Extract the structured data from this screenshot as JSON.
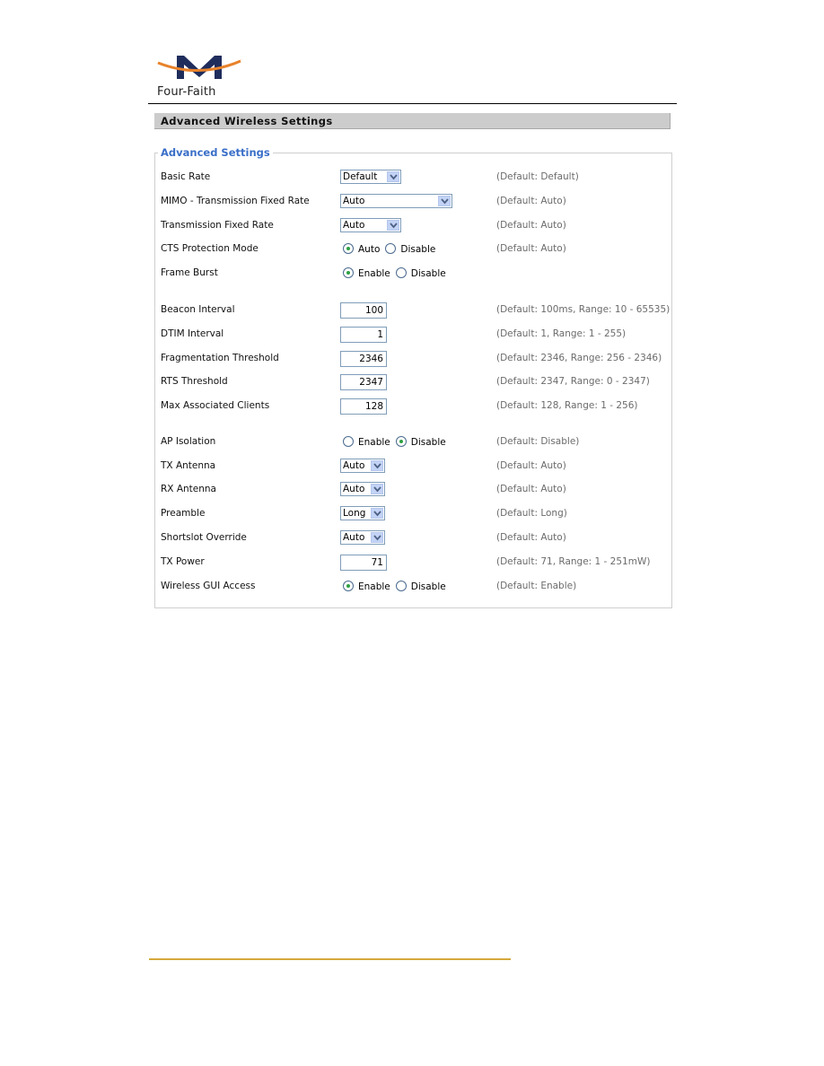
{
  "brand": {
    "name": "Four-Faith",
    "colors": {
      "mark": "#1f2d5c",
      "swoosh": "#e8822a",
      "footer_rule": "#d4a93a",
      "legend": "#3a6fc8"
    }
  },
  "section_title": "Advanced Wireless Settings",
  "fieldset_legend": "Advanced Settings",
  "rows": [
    {
      "label": "Basic Rate",
      "type": "select",
      "value": "Default",
      "hint": "(Default: Default)"
    },
    {
      "label": "MIMO - Transmission Fixed Rate",
      "type": "select",
      "value": "Auto",
      "hint": "(Default: Auto)"
    },
    {
      "label": "Transmission Fixed Rate",
      "type": "select",
      "value": "Auto",
      "hint": "(Default: Auto)"
    },
    {
      "label": "CTS Protection Mode",
      "type": "radio",
      "options": [
        "Auto",
        "Disable"
      ],
      "selected": "Auto",
      "hint": "(Default: Auto)"
    },
    {
      "label": "Frame Burst",
      "type": "radio",
      "options": [
        "Enable",
        "Disable"
      ],
      "selected": "Enable",
      "hint": ""
    },
    {
      "label": "Beacon Interval",
      "type": "text",
      "value": "100",
      "hint": "(Default: 100ms, Range: 10 - 65535)"
    },
    {
      "label": "DTIM Interval",
      "type": "text",
      "value": "1",
      "hint": "(Default: 1, Range: 1 - 255)"
    },
    {
      "label": "Fragmentation Threshold",
      "type": "text",
      "value": "2346",
      "hint": "(Default: 2346, Range: 256 - 2346)"
    },
    {
      "label": "RTS Threshold",
      "type": "text",
      "value": "2347",
      "hint": "(Default: 2347, Range: 0 - 2347)"
    },
    {
      "label": "Max Associated Clients",
      "type": "text",
      "value": "128",
      "hint": "(Default: 128, Range: 1 - 256)"
    },
    {
      "label": "AP Isolation",
      "type": "radio",
      "options": [
        "Enable",
        "Disable"
      ],
      "selected": "Disable",
      "hint": "(Default: Disable)"
    },
    {
      "label": "TX Antenna",
      "type": "select",
      "value": "Auto",
      "hint": "(Default: Auto)"
    },
    {
      "label": "RX Antenna",
      "type": "select",
      "value": "Auto",
      "hint": "(Default: Auto)"
    },
    {
      "label": "Preamble",
      "type": "select",
      "value": "Long",
      "hint": "(Default: Long)"
    },
    {
      "label": "Shortslot Override",
      "type": "select",
      "value": "Auto",
      "hint": "(Default: Auto)"
    },
    {
      "label": "TX Power",
      "type": "text",
      "value": "71",
      "hint": "(Default: 71, Range: 1 - 251mW)"
    },
    {
      "label": "Wireless GUI Access",
      "type": "radio",
      "options": [
        "Enable",
        "Disable"
      ],
      "selected": "Enable",
      "hint": "(Default: Enable)"
    }
  ]
}
